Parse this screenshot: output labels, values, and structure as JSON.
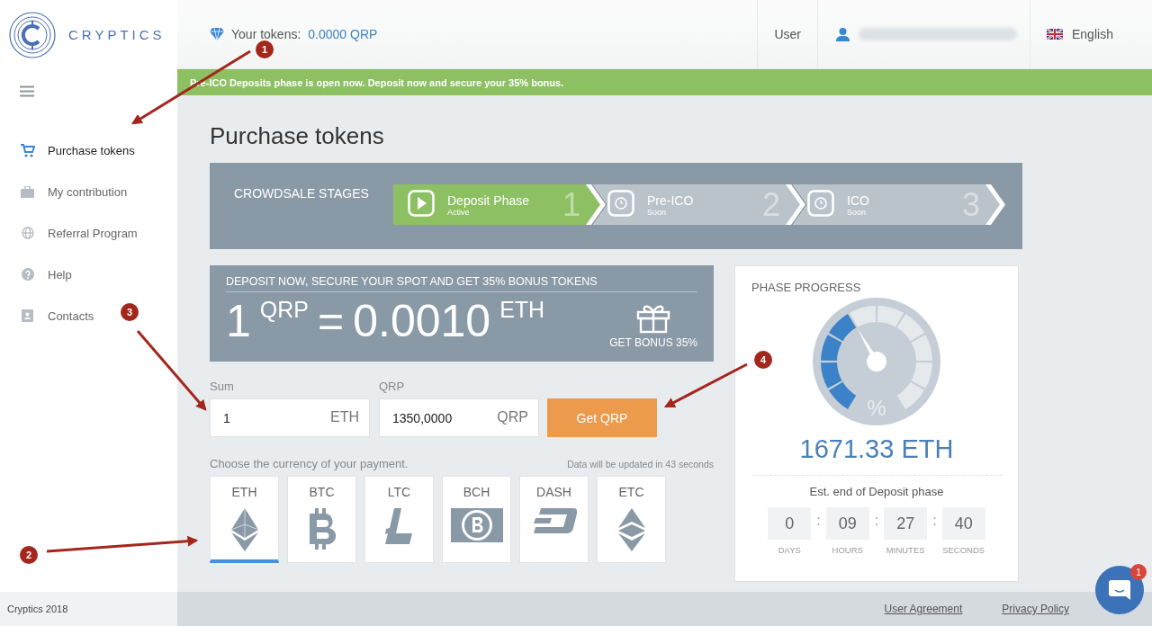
{
  "logo": {
    "name": "CRYPTICS"
  },
  "header": {
    "tokens_label": "Your tokens:",
    "tokens_value": "0.0000 QRP",
    "user_label": "User",
    "language": "English"
  },
  "banner": {
    "text": "Pre-ICO Deposits phase is open now. Deposit now and secure your 35% bonus."
  },
  "sidebar": {
    "items": [
      {
        "label": "Purchase tokens",
        "kind": "cart",
        "selected": true
      },
      {
        "label": "My contribution",
        "kind": "briefcase",
        "selected": false
      },
      {
        "label": "Referral Program",
        "kind": "globe",
        "selected": false
      },
      {
        "label": "Help",
        "kind": "help",
        "selected": false
      },
      {
        "label": "Contacts",
        "kind": "contacts",
        "selected": false
      }
    ]
  },
  "page_title": "Purchase tokens",
  "stages": {
    "title": "CROWDSALE STAGES",
    "items": [
      {
        "name": "Deposit Phase",
        "status": "Active",
        "number": "1",
        "selected": true
      },
      {
        "name": "Pre-ICO",
        "status": "Soon",
        "number": "2",
        "selected": false
      },
      {
        "name": "ICO",
        "status": "Soon",
        "number": "3",
        "selected": false
      }
    ]
  },
  "offer": {
    "heading": "DEPOSIT NOW, SECURE YOUR SPOT AND GET 35% BONUS TOKENS",
    "amount": "1",
    "unit": "QRP",
    "equals": "=",
    "price": "0.0010",
    "price_unit": "ETH",
    "bonus": "GET BONUS 35%"
  },
  "form": {
    "sum_label": "Sum",
    "sum_value": "1",
    "sum_unit": "ETH",
    "qrp_label": "QRP",
    "qrp_value": "1350,0000",
    "qrp_unit": "QRP",
    "button": "Get QRP"
  },
  "currency": {
    "prompt": "Choose the currency of your payment.",
    "note": "Data will be updated in 43 seconds",
    "items": [
      {
        "label": "ETH",
        "kind": "eth",
        "selected": true
      },
      {
        "label": "BTC",
        "kind": "btc",
        "selected": false
      },
      {
        "label": "LTC",
        "kind": "ltc",
        "selected": false
      },
      {
        "label": "BCH",
        "kind": "bch",
        "selected": false
      },
      {
        "label": "DASH",
        "kind": "dash",
        "selected": false
      },
      {
        "label": "ETC",
        "kind": "etc",
        "selected": false
      }
    ]
  },
  "progress": {
    "title": "PHASE PROGRESS",
    "unit_symbol": "%",
    "amount": "1671.33 ETH",
    "end_label": "Est. end of Deposit phase",
    "countdown": [
      {
        "value": "0",
        "label": "DAYS",
        "separator": ":"
      },
      {
        "value": "09",
        "label": "HOURS",
        "separator": ":"
      },
      {
        "value": "27",
        "label": "MINUTES",
        "separator": ":"
      },
      {
        "value": "40",
        "label": "SECONDS"
      }
    ]
  },
  "footer": {
    "copyright": "Cryptics 2018",
    "links": [
      "User Agreement",
      "Privacy Policy"
    ]
  },
  "chat": {
    "badge": "1"
  },
  "annotations": [
    {
      "number": "1"
    },
    {
      "number": "2"
    },
    {
      "number": "3"
    },
    {
      "number": "4"
    }
  ]
}
